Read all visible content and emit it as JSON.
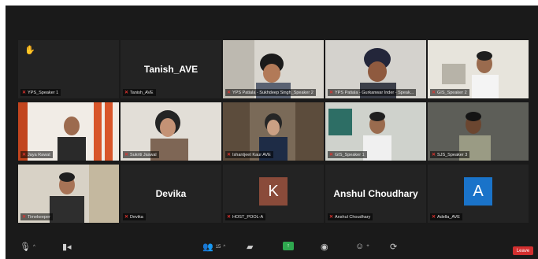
{
  "participants": [
    {
      "label": "YPS_Speaker 1",
      "center_name": "",
      "avatar": "",
      "hand": "✋"
    },
    {
      "label": "Tanish_AVE",
      "center_name": "Tanish_AVE",
      "avatar": ""
    },
    {
      "label": "YPS Patiala - Sukhdeep Singh_Speaker 2",
      "center_name": "",
      "avatar": ""
    },
    {
      "label": "YPS Patiala - Gurkanwar Inder - Speak...",
      "center_name": "",
      "avatar": ""
    },
    {
      "label": "GIS_Speaker 2",
      "center_name": "",
      "avatar": ""
    },
    {
      "label": "Jaya Rawat",
      "center_name": "",
      "avatar": ""
    },
    {
      "label": "Sukriti Jaswal",
      "center_name": "",
      "avatar": ""
    },
    {
      "label": "Ishantjeet Kaur AVE",
      "center_name": "",
      "avatar": ""
    },
    {
      "label": "GIS_Speaker 1",
      "center_name": "",
      "avatar": ""
    },
    {
      "label": "SJS_Speaker 3",
      "center_name": "",
      "avatar": ""
    },
    {
      "label": "Timekeeper",
      "center_name": "",
      "avatar": ""
    },
    {
      "label": "Devika",
      "center_name": "Devika",
      "avatar": ""
    },
    {
      "label": "HOST_POOL-A",
      "center_name": "",
      "avatar": "K"
    },
    {
      "label": "Anshul Choudhary",
      "center_name": "Anshul Choudhary",
      "avatar": ""
    },
    {
      "label": "Adella_AVE",
      "center_name": "",
      "avatar": "A"
    }
  ],
  "toolbar": {
    "participants_count": "15",
    "leave_label": "Leave"
  },
  "colors": {
    "avatar_k": "#8a4b3a",
    "avatar_a": "#1a73c9",
    "active_border": "#8fd14f",
    "leave": "#d32f2f",
    "share": "#2fa84f"
  }
}
